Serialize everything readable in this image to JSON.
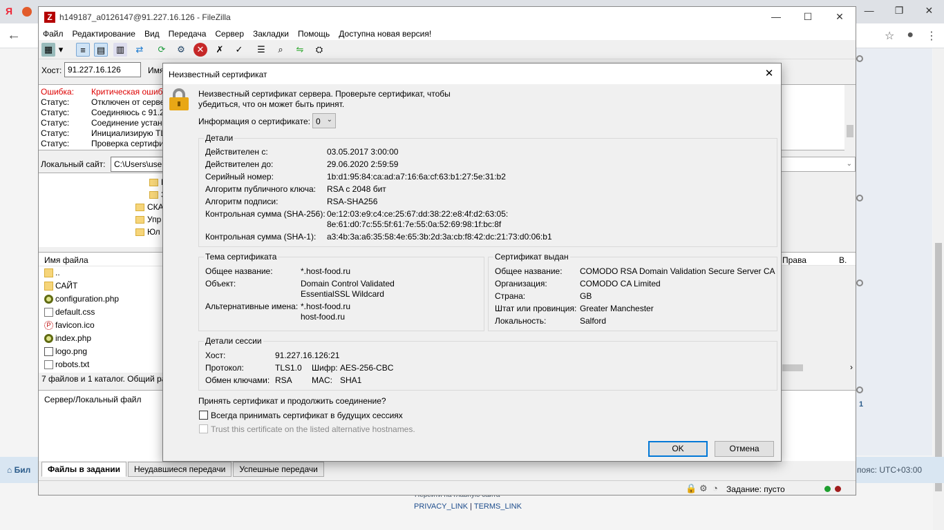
{
  "browser": {
    "logo": "Я",
    "controls": [
      "—",
      "❐",
      "✕"
    ],
    "footer_left": "Бил",
    "footer_right": "пояс: UTC+03:00",
    "footer_home": "Перейти на главную сайта",
    "privacy_link": "PRIVACY_LINK",
    "separator": "|",
    "terms_link": "TERMS_LINK",
    "side_number": "1"
  },
  "filezilla": {
    "title": "h149187_a0126147@91.227.16.126 - FileZilla",
    "menu": [
      "Файл",
      "Редактирование",
      "Вид",
      "Передача",
      "Сервер",
      "Закладки",
      "Помощь",
      "Доступна новая версия!"
    ],
    "quickconnect": {
      "host_label": "Хост:",
      "host_value": "91.227.16.126",
      "user_label": "Имя"
    },
    "log": [
      {
        "key": "Ошибка:",
        "text": "Критическая ошибк",
        "error": true
      },
      {
        "key": "Статус:",
        "text": "Отключен от серве"
      },
      {
        "key": "Статус:",
        "text": "Соединяюсь с 91.22"
      },
      {
        "key": "Статус:",
        "text": "Соединение устано"
      },
      {
        "key": "Статус:",
        "text": "Инициализирую TL"
      },
      {
        "key": "Статус:",
        "text": "Проверка сертифи"
      }
    ],
    "local_site_label": "Локальный сайт:",
    "local_site_value": "C:\\Users\\user",
    "tree": [
      "Б",
      "З",
      "СКА",
      "Упр",
      "Юл"
    ],
    "files_header": "Имя файла",
    "files": [
      {
        "name": "..",
        "type": "folder"
      },
      {
        "name": "САЙТ",
        "type": "folder"
      },
      {
        "name": "configuration.php",
        "type": "php"
      },
      {
        "name": "default.css",
        "type": "css"
      },
      {
        "name": "favicon.ico",
        "type": "ico"
      },
      {
        "name": "index.php",
        "type": "php"
      },
      {
        "name": "logo.png",
        "type": "png"
      },
      {
        "name": "robots.txt",
        "type": "css"
      }
    ],
    "summary": "7 файлов и 1 каталог. Общий ра",
    "remote_headers": [
      "Права",
      "В."
    ],
    "queue_header": "Сервер/Локальный файл",
    "tabs": [
      "Файлы в задании",
      "Неудавшиеся передачи",
      "Успешные передачи"
    ],
    "queue_status": "Задание: пусто"
  },
  "dialog": {
    "title": "Неизвестный сертификат",
    "intro": "Неизвестный сертификат сервера. Проверьте сертификат, чтобы убедиться, что он может быть принят.",
    "cert_info_label": "Информация о сертификате:",
    "cert_info_value": "0",
    "details": {
      "title": "Детали",
      "rows": [
        {
          "k": "Действителен с:",
          "v": "03.05.2017 3:00:00"
        },
        {
          "k": "Действителен до:",
          "v": "29.06.2020 2:59:59"
        },
        {
          "k": "Серийный номер:",
          "v": "1b:d1:95:84:ca:ad:a7:16:6a:cf:63:b1:27:5e:31:b2"
        },
        {
          "k": "Алгоритм публичного ключа:",
          "v": "RSA с 2048 бит"
        },
        {
          "k": "Алгоритм подписи:",
          "v": "RSA-SHA256"
        },
        {
          "k": "Контрольная сумма (SHA-256):",
          "v": "0e:12:03:e9:c4:ce:25:67:dd:38:22:e8:4f:d2:63:05:",
          "v2": "8e:61:d0:7c:55:5f:61:7e:55:0a:52:69:98:1f:bc:8f"
        },
        {
          "k": "Контрольная сумма (SHA-1):",
          "v": "a3:4b:3a:a6:35:58:4e:65:3b:2d:3a:cb:f8:42:dc:21:73:d0:06:b1"
        }
      ]
    },
    "subject": {
      "title": "Тема сертификата",
      "common_name_label": "Общее название:",
      "common_name": "*.host-food.ru",
      "object_label": "Объект:",
      "object_1": "Domain Control Validated",
      "object_2": "EssentialSSL Wildcard",
      "alt_label": "Альтернативные имена:",
      "alt_1": "*.host-food.ru",
      "alt_2": "host-food.ru"
    },
    "issuer": {
      "title": "Сертификат выдан",
      "rows": [
        {
          "k": "Общее название:",
          "v": "COMODO RSA Domain Validation Secure Server CA"
        },
        {
          "k": "Организация:",
          "v": "COMODO CA Limited"
        },
        {
          "k": "Страна:",
          "v": "GB"
        },
        {
          "k": "Штат или провинция:",
          "v": "Greater Manchester"
        },
        {
          "k": "Локальность:",
          "v": "Salford"
        }
      ]
    },
    "session": {
      "title": "Детали сессии",
      "host_label": "Хост:",
      "host": "91.227.16.126:21",
      "protocol_label": "Протокол:",
      "protocol": "TLS1.0",
      "cipher_label": "Шифр:",
      "cipher": "AES-256-CBC",
      "kex_label": "Обмен ключами:",
      "kex": "RSA",
      "mac_label": "MAC:",
      "mac": "SHA1"
    },
    "question": "Принять сертификат и продолжить соединение?",
    "always_accept": "Всегда принимать сертификат в будущих сессиях",
    "trust_alt": "Trust this certificate on the listed alternative hostnames.",
    "ok": "OK",
    "cancel": "Отмена"
  }
}
